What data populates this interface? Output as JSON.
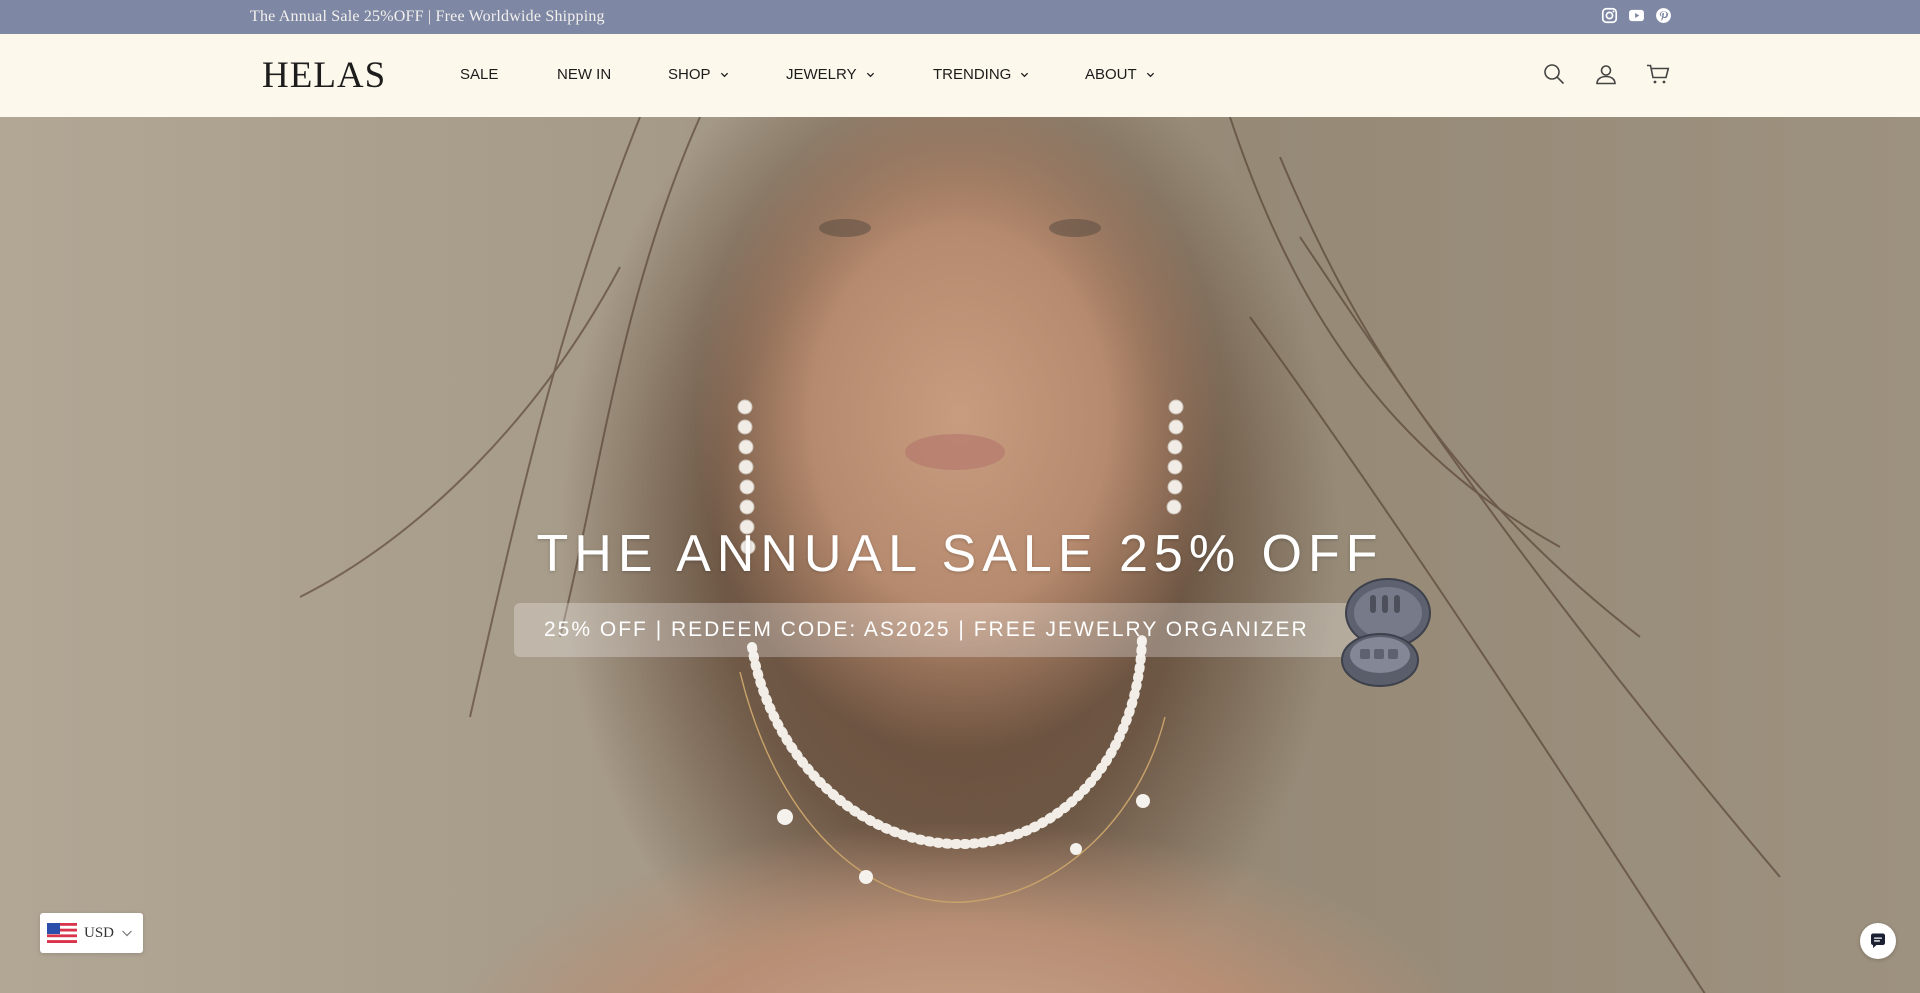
{
  "announcement": {
    "text": "The Annual Sale 25%OFF | Free Worldwide Shipping",
    "social_icons": [
      "instagram-icon",
      "youtube-icon",
      "pinterest-icon"
    ]
  },
  "header": {
    "logo": "HELAS",
    "nav": [
      {
        "label": "SALE",
        "has_dropdown": false
      },
      {
        "label": "NEW IN",
        "has_dropdown": false
      },
      {
        "label": "SHOP",
        "has_dropdown": true
      },
      {
        "label": "JEWELRY",
        "has_dropdown": true
      },
      {
        "label": "TRENDING",
        "has_dropdown": true
      },
      {
        "label": "ABOUT",
        "has_dropdown": true
      }
    ],
    "icons": [
      "search-icon",
      "account-icon",
      "cart-icon"
    ]
  },
  "hero": {
    "title": "THE ANNUAL SALE 25% OFF",
    "promo": "25% OFF  |  REDEEM CODE: AS2025  |  FREE JEWELRY ORGANIZER"
  },
  "currency": {
    "label": "USD",
    "flag": "us-flag-icon"
  },
  "chat": {
    "icon": "chat-icon"
  },
  "colors": {
    "announcement_bg": "#7e87a3",
    "header_bg": "#fdf8ec",
    "text_dark": "#1c1c1c",
    "hero_text": "#ffffff"
  }
}
